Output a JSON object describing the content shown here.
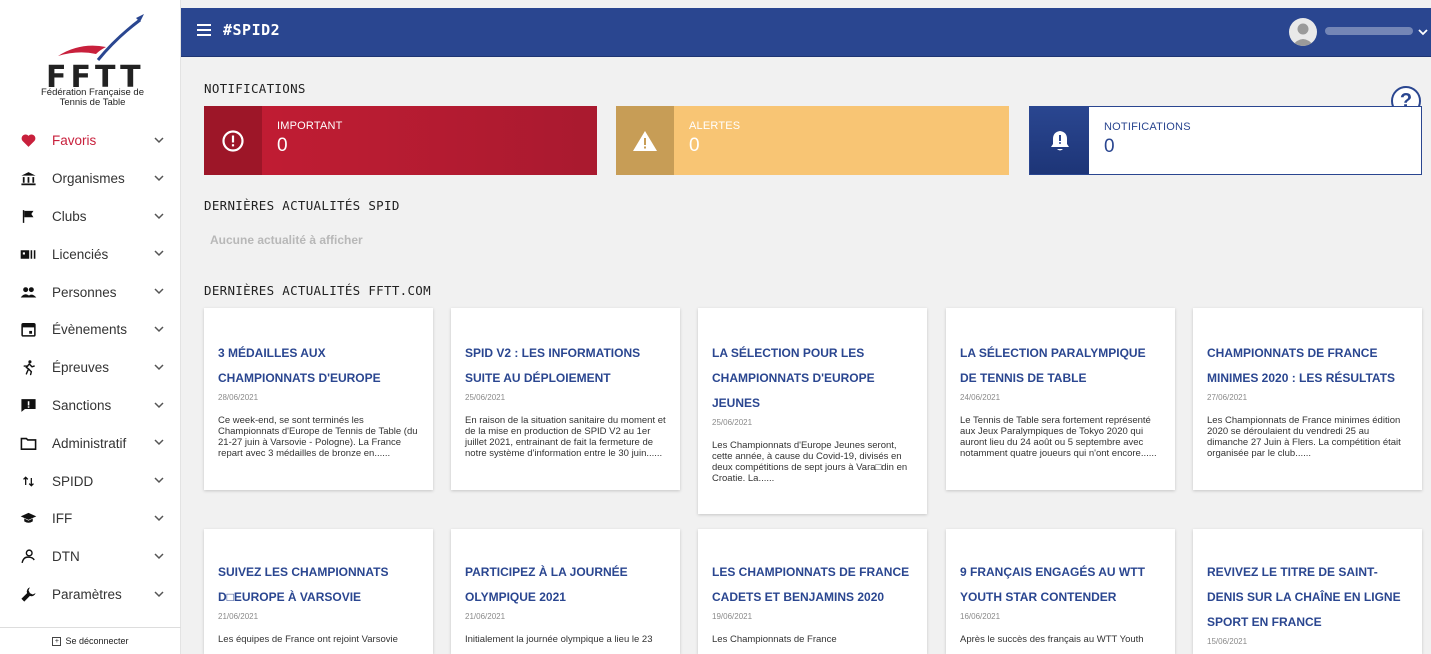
{
  "sidebar": {
    "logo_text": "FFTT",
    "logo_subtitle": "Fédération Française de Tennis de Table",
    "items": [
      {
        "label": "Favoris",
        "icon": "heart-icon"
      },
      {
        "label": "Organismes",
        "icon": "institution-icon"
      },
      {
        "label": "Clubs",
        "icon": "flag-icon"
      },
      {
        "label": "Licenciés",
        "icon": "id-card-icon"
      },
      {
        "label": "Personnes",
        "icon": "people-icon"
      },
      {
        "label": "Évènements",
        "icon": "calendar-icon"
      },
      {
        "label": "Épreuves",
        "icon": "runner-icon"
      },
      {
        "label": "Sanctions",
        "icon": "alert-message-icon"
      },
      {
        "label": "Administratif",
        "icon": "folder-icon"
      },
      {
        "label": "SPIDD",
        "icon": "sort-arrows-icon"
      },
      {
        "label": "IFF",
        "icon": "graduation-cap-icon"
      },
      {
        "label": "DTN",
        "icon": "person-outline-icon"
      },
      {
        "label": "Paramètres",
        "icon": "wrench-icon"
      }
    ],
    "logout_label": "Se déconnecter"
  },
  "header": {
    "title": "#SPID2"
  },
  "sections": {
    "notifications": "NOTIFICATIONS",
    "spid_news": "DERNIÈRES ACTUALITÉS SPID",
    "spid_empty": "Aucune actualité à afficher",
    "fftt_news": "DERNIÈRES ACTUALITÉS FFTT.COM"
  },
  "cards": {
    "important": {
      "label": "IMPORTANT",
      "count": "0"
    },
    "alerts": {
      "label": "ALERTES",
      "count": "0"
    },
    "notifications": {
      "label": "NOTIFICATIONS",
      "count": "0"
    }
  },
  "news": [
    {
      "title": "3 MÉDAILLES AUX CHAMPIONNATS D'EUROPE",
      "date": "28/06/2021",
      "desc": "Ce week-end, se sont terminés les Championnats d'Europe de Tennis de Table (du 21-27 juin à Varsovie - Pologne). La France repart avec 3 médailles de bronze en......"
    },
    {
      "title": "SPID V2 : LES INFORMATIONS SUITE AU DÉPLOIEMENT",
      "date": "25/06/2021",
      "desc": "En raison de la situation sanitaire du moment et de la mise en production de SPID V2 au 1er juillet 2021, entrainant de fait la fermeture de notre système d'information entre le 30 juin......"
    },
    {
      "title": "LA SÉLECTION POUR LES CHAMPIONNATS D'EUROPE JEUNES",
      "date": "25/06/2021",
      "desc": "Les Championnats d'Europe Jeunes seront, cette année, à cause du Covid-19, divisés en deux compétitions de sept jours à Vara□din en Croatie. La......"
    },
    {
      "title": "LA SÉLECTION PARALYMPIQUE DE TENNIS DE TABLE",
      "date": "24/06/2021",
      "desc": "Le Tennis de Table sera fortement représenté aux Jeux Paralympiques de Tokyo 2020 qui auront lieu du 24 août ou 5 septembre avec notamment quatre joueurs qui n'ont encore......"
    },
    {
      "title": "CHAMPIONNATS DE FRANCE MINIMES 2020 : LES RÉSULTATS",
      "date": "27/06/2021",
      "desc": "Les Championnats de France minimes édition 2020 se déroulaient du vendredi 25 au dimanche 27 Juin à Flers. La compétition était organisée par le club......"
    },
    {
      "title": "SUIVEZ LES CHAMPIONNATS D□EUROPE À VARSOVIE",
      "date": "21/06/2021",
      "desc": "Les équipes de France ont rejoint Varsovie"
    },
    {
      "title": "PARTICIPEZ À LA JOURNÉE OLYMPIQUE 2021",
      "date": "21/06/2021",
      "desc": "Initialement la journée olympique a lieu le 23"
    },
    {
      "title": "LES CHAMPIONNATS DE FRANCE CADETS ET BENJAMINS 2020",
      "date": "19/06/2021",
      "desc": "Les Championnats de France"
    },
    {
      "title": "9 FRANÇAIS ENGAGÉS AU WTT YOUTH STAR CONTENDER",
      "date": "16/06/2021",
      "desc": "Après le succès des français au WTT Youth"
    },
    {
      "title": "REVIVEZ LE TITRE DE SAINT-DENIS SUR LA CHAÎNE EN LIGNE SPORT EN FRANCE",
      "date": "15/06/2021",
      "desc": ""
    }
  ],
  "colors": {
    "primary": "#2a4690",
    "important": "#c41d34",
    "alert": "#f8c574",
    "favorite": "#c8203c"
  }
}
